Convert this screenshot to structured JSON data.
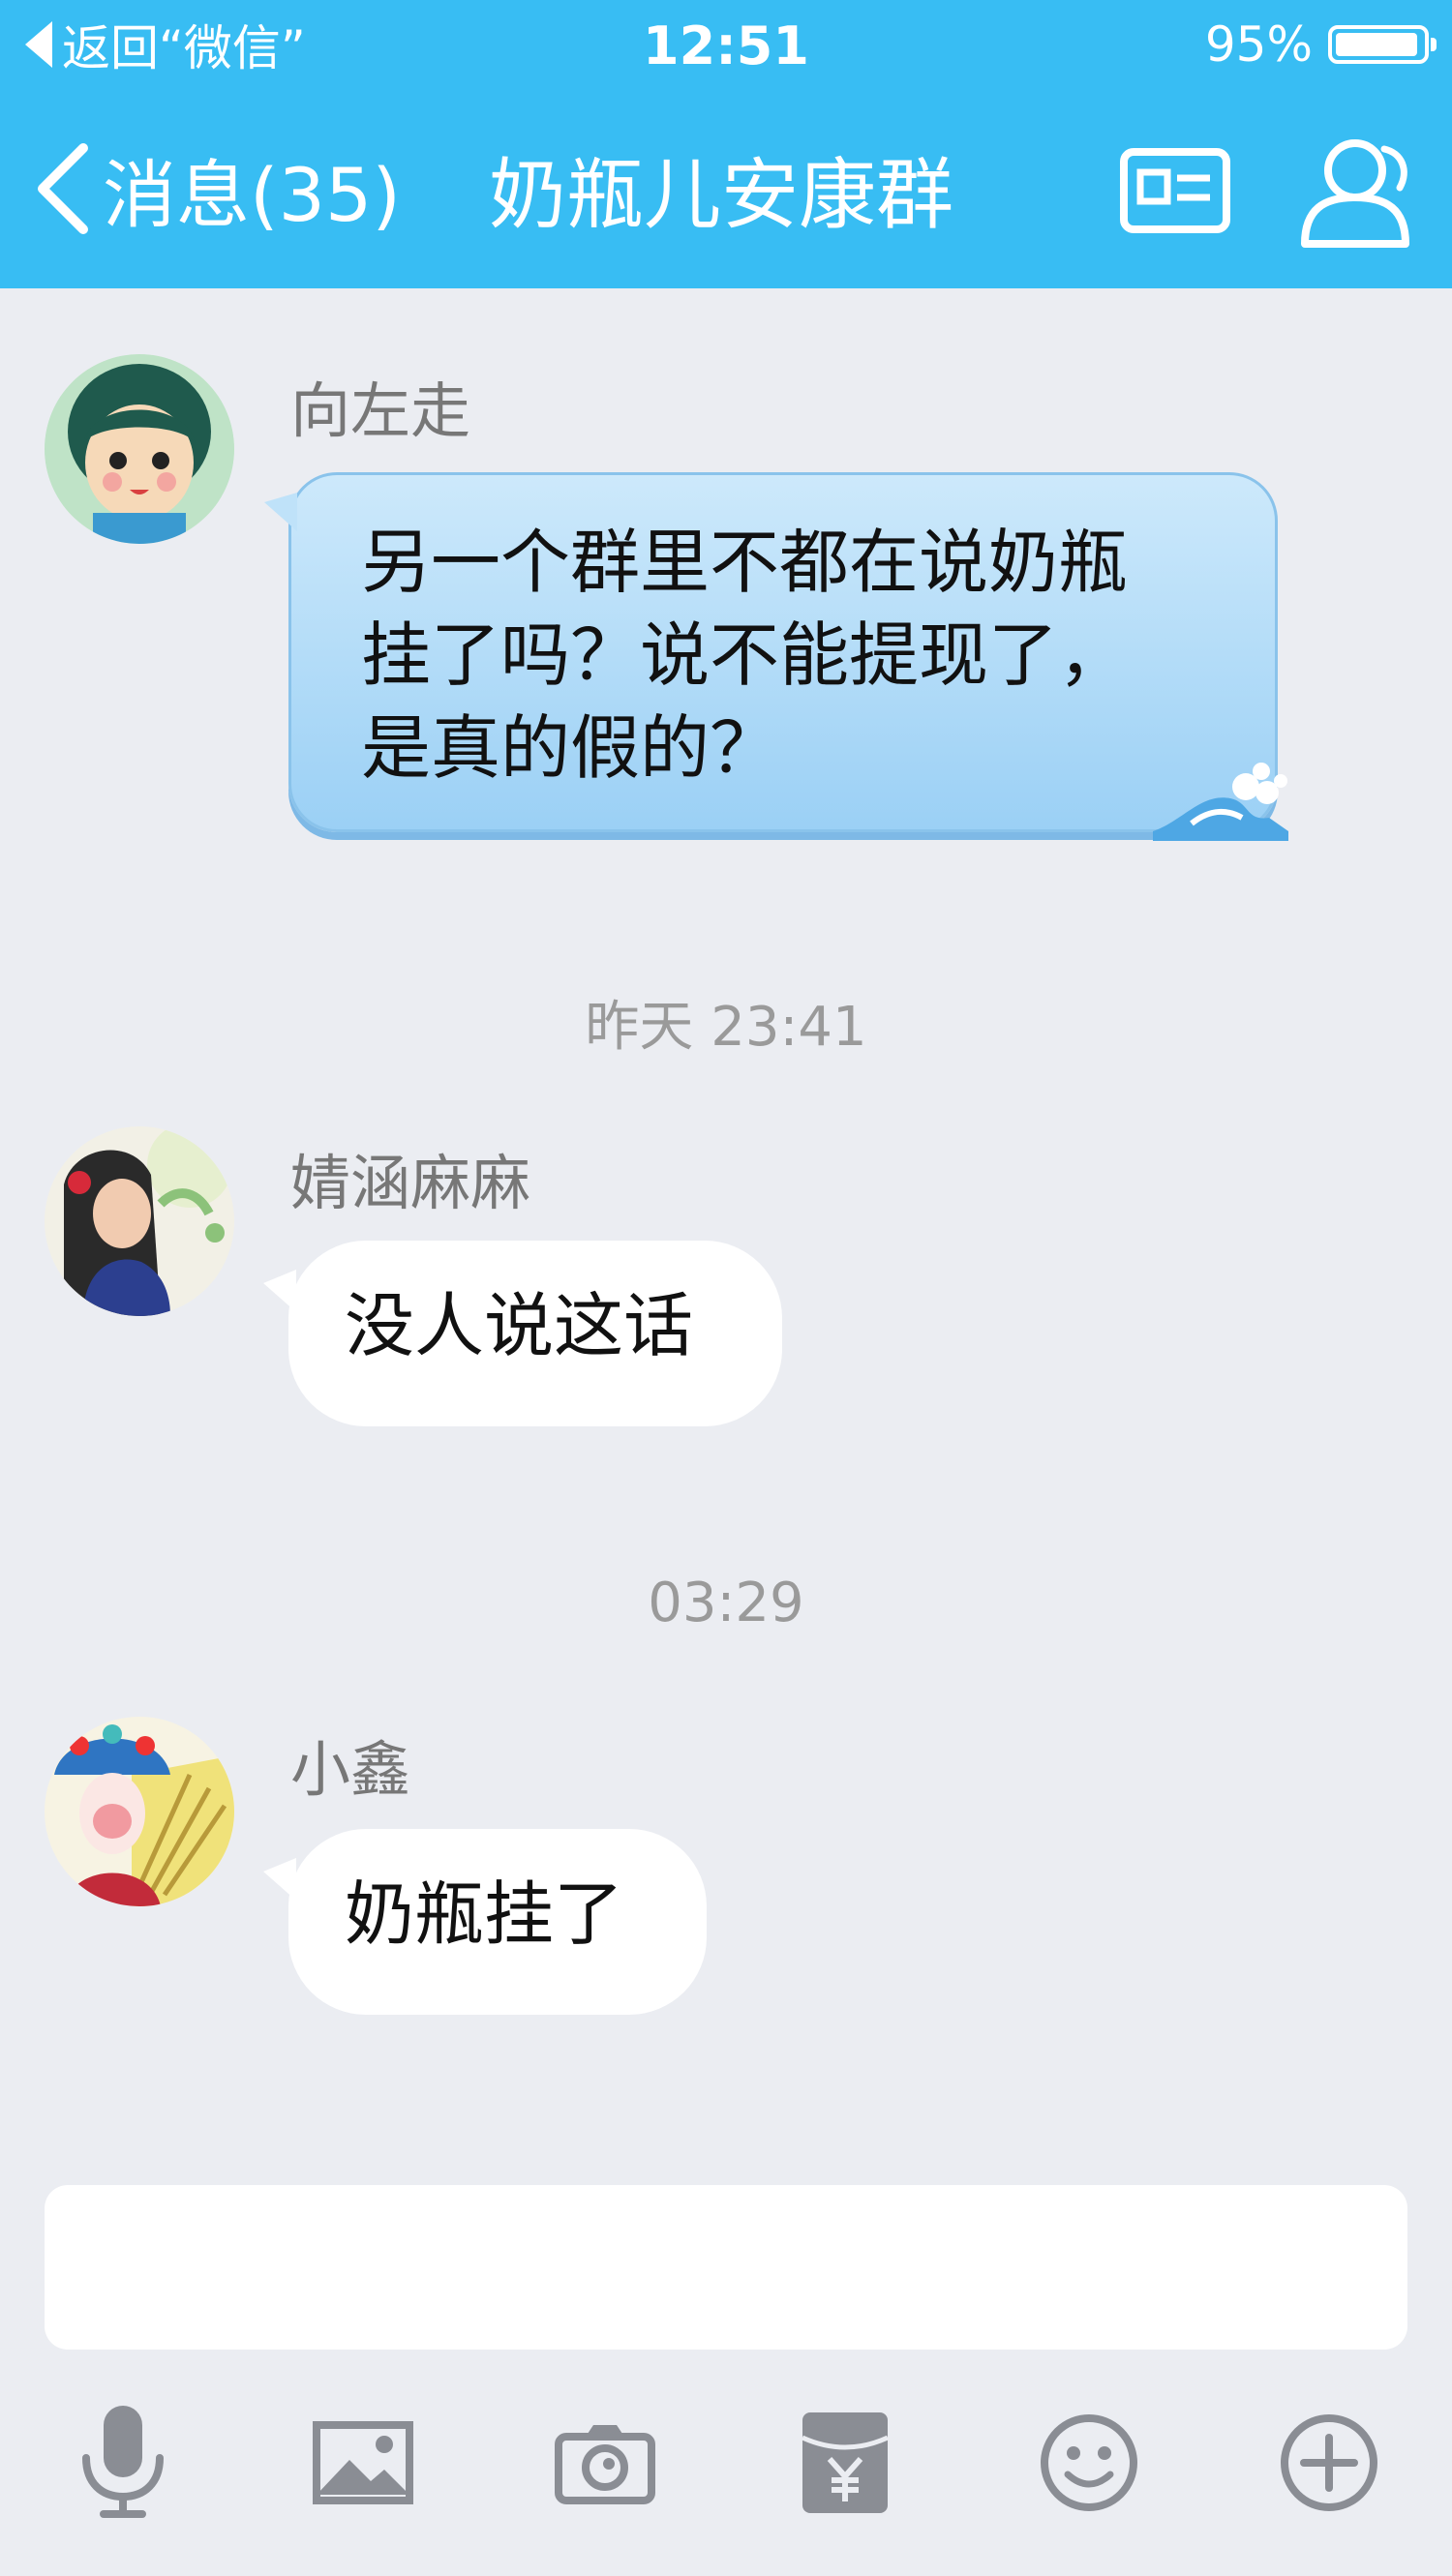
{
  "status_bar": {
    "back_label": "返回“微信”",
    "time": "12:51",
    "battery_text": "95%",
    "battery_level": 0.95
  },
  "nav": {
    "back_label": "消息(35)",
    "title": "奶瓶儿安康群",
    "icons": [
      "chevron-left-icon",
      "group-card-icon",
      "group-members-icon"
    ]
  },
  "messages": [
    {
      "sender": "向左走",
      "text_lines": [
        "另一个群里不都在说奶瓶",
        "挂了吗？说不能提现了，",
        "是真的假的？"
      ],
      "style": "blue"
    },
    {
      "timestamp": "昨天 23:41"
    },
    {
      "sender": "婧涵麻麻",
      "text": "没人说这话",
      "style": "white"
    },
    {
      "timestamp": "03:29"
    },
    {
      "sender": "小鑫",
      "text": "奶瓶挂了",
      "style": "white"
    }
  ],
  "input": {
    "value": ""
  },
  "toolbar": {
    "items": [
      "microphone-icon",
      "image-icon",
      "camera-icon",
      "red-packet-icon",
      "emoji-icon",
      "plus-icon"
    ]
  },
  "colors": {
    "header": "#38bdf3",
    "background": "#ebedf2",
    "toolbar_icon": "#8a8d94"
  }
}
